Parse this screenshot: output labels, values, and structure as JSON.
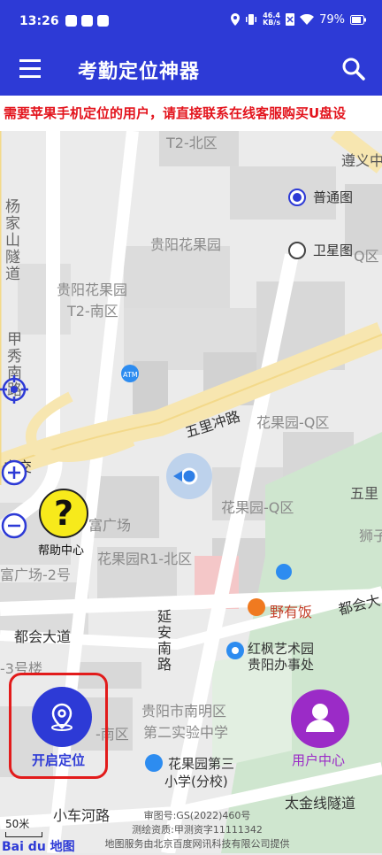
{
  "status_bar": {
    "time": "13:26",
    "speed_top": "46.4",
    "speed_bottom": "KB/s",
    "battery": "79%"
  },
  "app_bar": {
    "title": "考勤定位神器"
  },
  "notice": {
    "text": "需要苹果手机定位的用户，请直接联系在线客服购买U盘设"
  },
  "map_type": {
    "normal": "普通图",
    "satellite": "卫星图"
  },
  "map_labels": {
    "t2_north": "T2-北区",
    "zunyi": "遵义中",
    "yangjiashan": "杨家山隧道",
    "huaguoyuan": "贵阳花果园",
    "huaguoyuan_t2_south_1": "贵阳花果园",
    "huaguoyuan_t2_south_2": "T2-南区",
    "jiaxiu": "甲秀南路",
    "wulichong": "五里冲路",
    "huaguoyuan_q_1": "花果园-Q区",
    "lijiao": "立交",
    "wuli": "五里",
    "shi": "狮子",
    "fuguangchang": "富广场",
    "huaguoyuan_q_2": "花果园-Q区",
    "r1_north": "花果园R1-北区",
    "fuguangchang2": "富广场-2号",
    "youyoufan": "野有饭",
    "duhui": "都会大道",
    "duhui2": "都会大",
    "yanan": "延安南路",
    "hongfeng_1": "红枫艺术园",
    "hongfeng_2": "贵阳办事处",
    "building3": "-3号楼",
    "nanming_1": "贵阳市南明区",
    "nanming_2": "第二实验中学",
    "south_area": "-南区",
    "school_1": "花果园第三",
    "school_2": "小学(分校)",
    "xiaochehe": "小车河路",
    "taijin": "太金线隧道",
    "q_right": "Q区"
  },
  "help": {
    "label": "帮助中心",
    "icon_char": "?"
  },
  "start": {
    "label": "开启定位"
  },
  "user_center": {
    "label": "用户中心"
  },
  "scale": {
    "label": "50米"
  },
  "copyright": {
    "line1": "审图号:GS(2022)460号",
    "line2": "测绘资质:甲测资字11111342",
    "line3": "地图服务由北京百度网讯科技有限公司提供"
  },
  "baidu_logo": "Bai du 地图",
  "colors": {
    "primary": "#2d3ad6",
    "notice": "#e3141d",
    "user": "#9b2bc7",
    "help": "#f7ea1b"
  }
}
